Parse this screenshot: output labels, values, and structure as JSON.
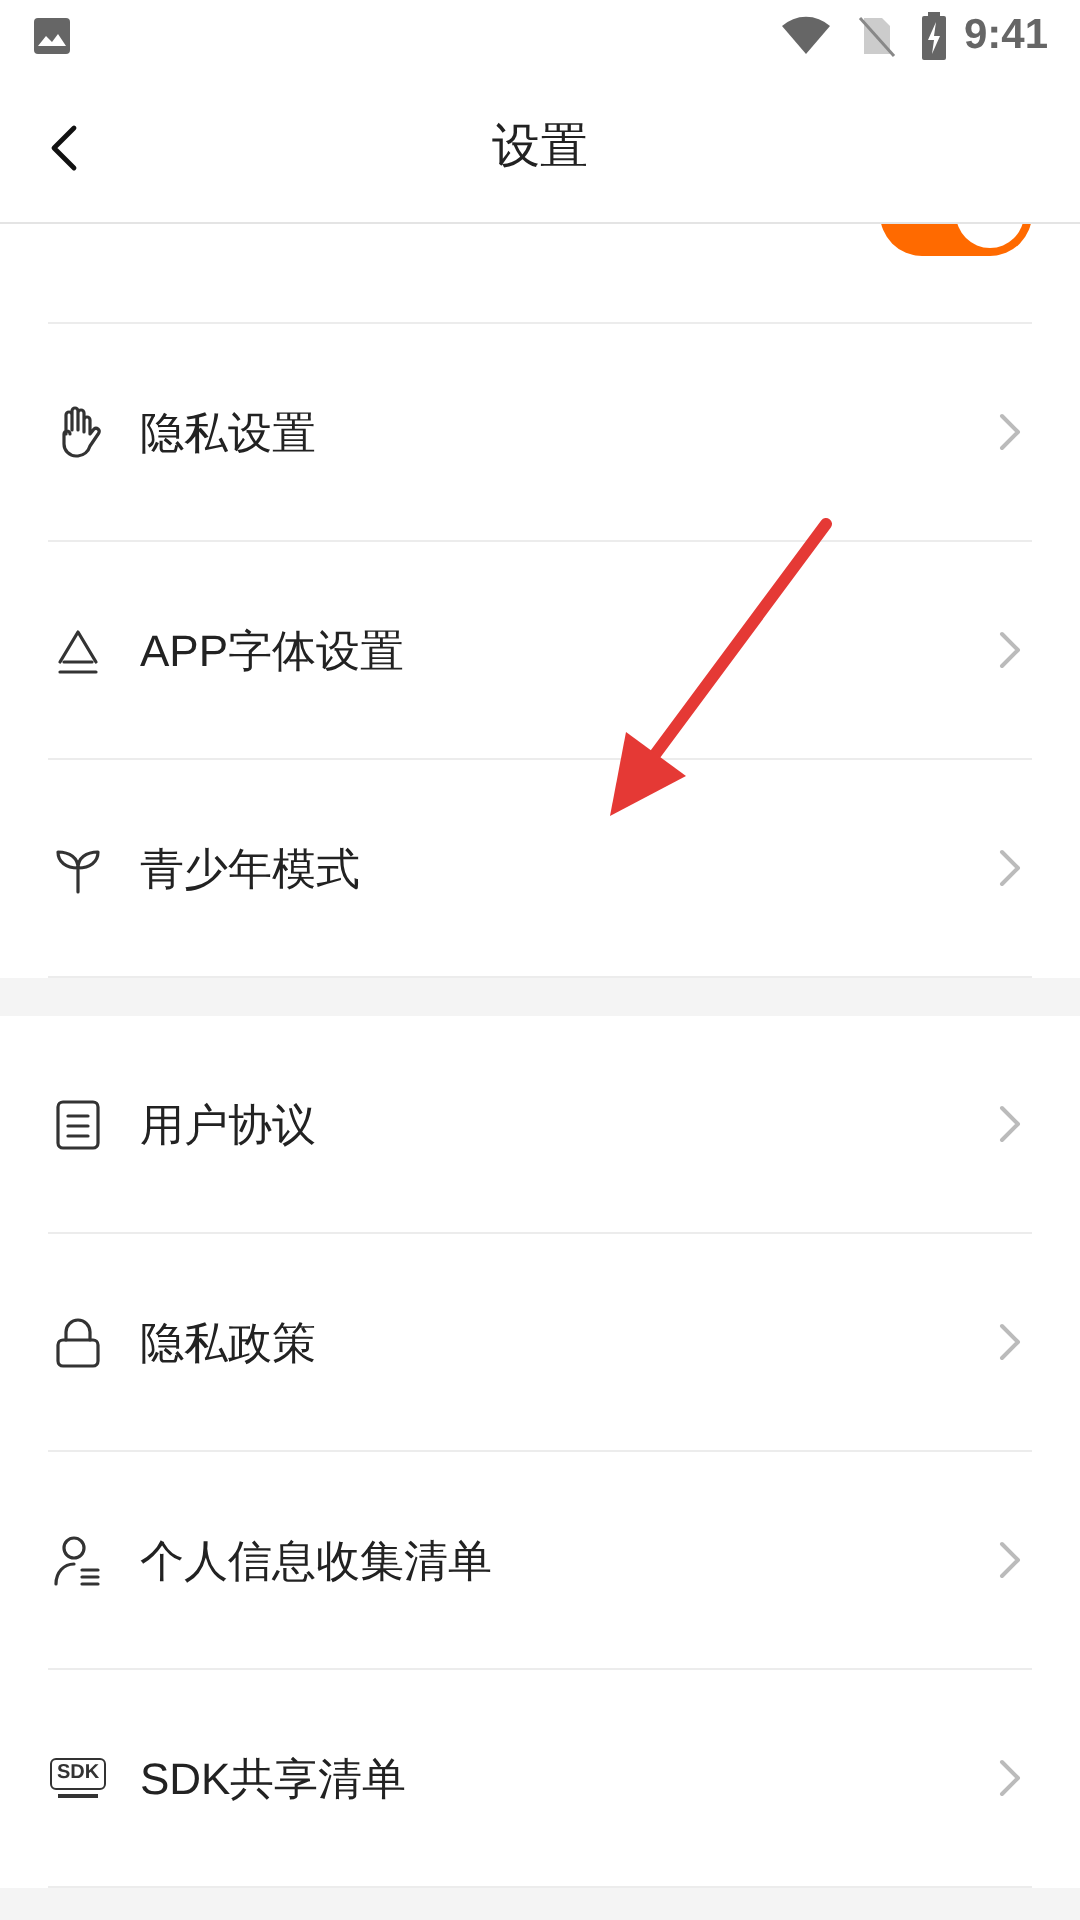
{
  "status_bar": {
    "time": "9:41"
  },
  "header": {
    "title": "设置"
  },
  "sections": [
    {
      "items": [
        {
          "kind": "toggle",
          "on": true
        },
        {
          "kind": "link",
          "label": "隐私设置"
        },
        {
          "kind": "link",
          "label": "APP字体设置"
        },
        {
          "kind": "link",
          "label": "青少年模式"
        }
      ]
    },
    {
      "items": [
        {
          "kind": "link",
          "label": "用户协议"
        },
        {
          "kind": "link",
          "label": "隐私政策"
        },
        {
          "kind": "link",
          "label": "个人信息收集清单"
        },
        {
          "kind": "link",
          "icon_text": "SDK",
          "label": "SDK共享清单"
        }
      ]
    }
  ]
}
